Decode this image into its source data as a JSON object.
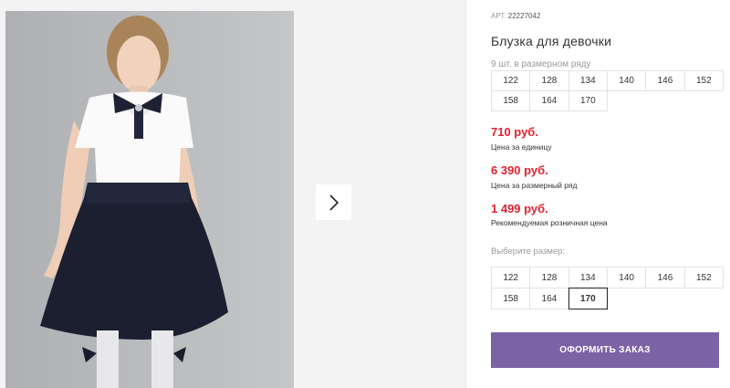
{
  "product": {
    "art_label": "АРТ.",
    "art_number": "22227042",
    "title": "Блузка для девочки",
    "pack_note": "9 шт. в размерном ряду"
  },
  "pack_sizes": [
    "122",
    "128",
    "134",
    "140",
    "146",
    "152",
    "158",
    "164",
    "170"
  ],
  "prices": {
    "unit_price": "710 руб.",
    "unit_label": "Цена за единицу",
    "pack_price": "6 390 руб.",
    "pack_label": "Цена за размерный ряд",
    "rrp_price": "1 499 руб.",
    "rrp_label": "Рекомендуемая розничная цена"
  },
  "size_select": {
    "label": "Выберите размер:",
    "options": [
      "122",
      "128",
      "134",
      "140",
      "146",
      "152",
      "158",
      "164",
      "170"
    ],
    "selected": "170"
  },
  "order_button": "ОФОРМИТЬ ЗАКАЗ",
  "gallery": {
    "next_icon": "chevron-right-icon"
  },
  "colors": {
    "price": "#e0232f",
    "accent": "#7b63a6"
  }
}
